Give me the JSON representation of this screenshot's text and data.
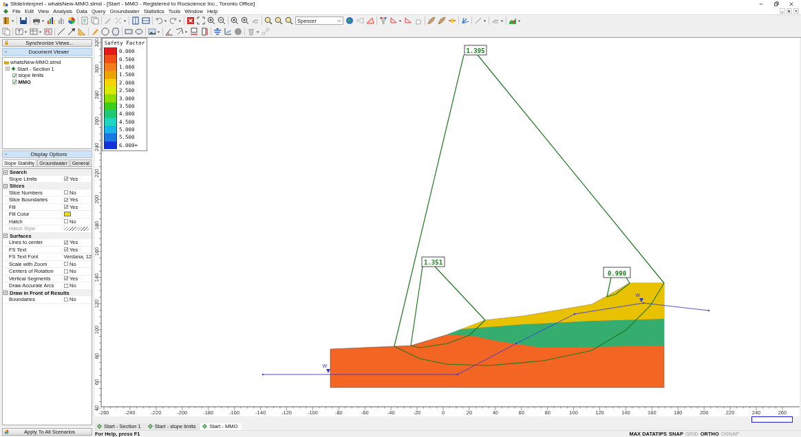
{
  "window": {
    "title": "SlideInterpret - whatsNew-MMO.slmd - [Start - MMO - Registered to Rocscience Inc., Toronto Office]"
  },
  "menu": [
    "File",
    "Edit",
    "View",
    "Analysis",
    "Data",
    "Query",
    "Groundwater",
    "Statistics",
    "Tools",
    "Window",
    "Help"
  ],
  "toolbar": {
    "method_dropdown": {
      "value": "Spencer"
    }
  },
  "sidebar": {
    "sync_button": "Synchronize Views...",
    "document_viewer": {
      "title": "Document Viewer",
      "tree": [
        {
          "label": "whatsNew-MMO.slmd",
          "children": [
            {
              "label": "Start - Section 1",
              "expanded": true,
              "children": [
                {
                  "label": "slope limits",
                  "checked": true,
                  "selected": false
                },
                {
                  "label": "MMO",
                  "checked": true,
                  "selected": true
                }
              ]
            }
          ]
        }
      ]
    },
    "display_options": {
      "title": "Display Options",
      "tabs": [
        {
          "label": "Slope Stability",
          "selected": true
        },
        {
          "label": "Groundwater",
          "selected": false
        },
        {
          "label": "General",
          "selected": false
        }
      ],
      "groups": [
        {
          "title": "Search",
          "expanded": true,
          "rows": [
            {
              "label": "Slope Limits",
              "kind": "check",
              "checked": true,
              "value": "Yes",
              "disabled": false
            }
          ]
        },
        {
          "title": "Slices",
          "expanded": true,
          "rows": [
            {
              "label": "Slice Numbers",
              "kind": "check",
              "checked": false,
              "value": "No",
              "disabled": false
            },
            {
              "label": "Slice Boundaries",
              "kind": "check",
              "checked": true,
              "value": "Yes",
              "disabled": false
            },
            {
              "label": "Fill",
              "kind": "check",
              "checked": true,
              "value": "Yes",
              "disabled": false
            },
            {
              "label": "Fill Color",
              "kind": "color",
              "color": "#f2dc00",
              "disabled": false
            },
            {
              "label": "Hatch",
              "kind": "check",
              "checked": false,
              "value": "No",
              "disabled": false
            },
            {
              "label": "Hatch Style",
              "kind": "hatch",
              "disabled": true
            }
          ]
        },
        {
          "title": "Surfaces",
          "expanded": true,
          "rows": [
            {
              "label": "Lines to center",
              "kind": "check",
              "checked": true,
              "value": "Yes",
              "disabled": false
            },
            {
              "label": "FS Text",
              "kind": "check",
              "checked": true,
              "value": "Yes",
              "disabled": false
            },
            {
              "label": "FS Text Font",
              "kind": "text",
              "value": "Verdana, 12",
              "disabled": false
            },
            {
              "label": "Scale with Zoom",
              "kind": "check",
              "checked": false,
              "value": "No",
              "disabled": false
            },
            {
              "label": "Centers of Rotation",
              "kind": "check",
              "checked": false,
              "value": "No",
              "disabled": false
            },
            {
              "label": "Vertical Segments",
              "kind": "check",
              "checked": true,
              "value": "Yes",
              "disabled": false
            },
            {
              "label": "Draw Accurate Arcs",
              "kind": "check",
              "checked": false,
              "value": "No",
              "disabled": false
            }
          ]
        },
        {
          "title": "Draw in Front of Results",
          "expanded": true,
          "rows": [
            {
              "label": "Boundaries",
              "kind": "check",
              "checked": false,
              "value": "No",
              "disabled": false
            }
          ]
        }
      ]
    },
    "apply_button": "Apply To All Scenarios"
  },
  "legend": {
    "title": "Safety Factor",
    "entries": [
      {
        "label": "0.000",
        "color": "#e3191c"
      },
      {
        "label": "0.500",
        "color": "#ef4f16"
      },
      {
        "label": "1.000",
        "color": "#f27d1a"
      },
      {
        "label": "1.500",
        "color": "#eba300"
      },
      {
        "label": "2.000",
        "color": "#f5d400"
      },
      {
        "label": "2.500",
        "color": "#d8ea00"
      },
      {
        "label": "3.000",
        "color": "#8ede00"
      },
      {
        "label": "3.500",
        "color": "#3ccf1a"
      },
      {
        "label": "4.000",
        "color": "#1ec874"
      },
      {
        "label": "4.500",
        "color": "#1ed6c0"
      },
      {
        "label": "5.000",
        "color": "#18b4ea"
      },
      {
        "label": "5.500",
        "color": "#1678e0"
      },
      {
        "label": "6.000+",
        "color": "#1432d8"
      }
    ]
  },
  "plot": {
    "fs_labels": [
      "1.395",
      "1.351",
      "0.990"
    ],
    "water_markers": [
      "W",
      "W"
    ],
    "x_ticks": [
      "-260",
      "-240",
      "-220",
      "-200",
      "-180",
      "-160",
      "-140",
      "-120",
      "-100",
      "-80",
      "-60",
      "-40",
      "-20",
      "0",
      "20",
      "40",
      "60",
      "80",
      "100",
      "120",
      "140",
      "160",
      "180",
      "200",
      "220",
      "240",
      "260"
    ],
    "y_ticks": [
      "40",
      "60",
      "80",
      "100",
      "120",
      "140",
      "160",
      "180",
      "200",
      "220",
      "240",
      "260",
      "280",
      "300",
      "320"
    ]
  },
  "view_tabs": [
    {
      "label": "Start - Section 1",
      "selected": false
    },
    {
      "label": "Start - slope limits",
      "selected": false
    },
    {
      "label": "Start - MMO",
      "selected": true
    }
  ],
  "status_bar": {
    "help": "For Help, press F1",
    "indicators": [
      {
        "label": "MAX DATATIPS",
        "on": true
      },
      {
        "label": "SNAP",
        "on": true
      },
      {
        "label": "GRID",
        "on": false
      },
      {
        "label": "ORTHO",
        "on": true
      },
      {
        "label": "OSNAP",
        "on": false
      }
    ]
  }
}
